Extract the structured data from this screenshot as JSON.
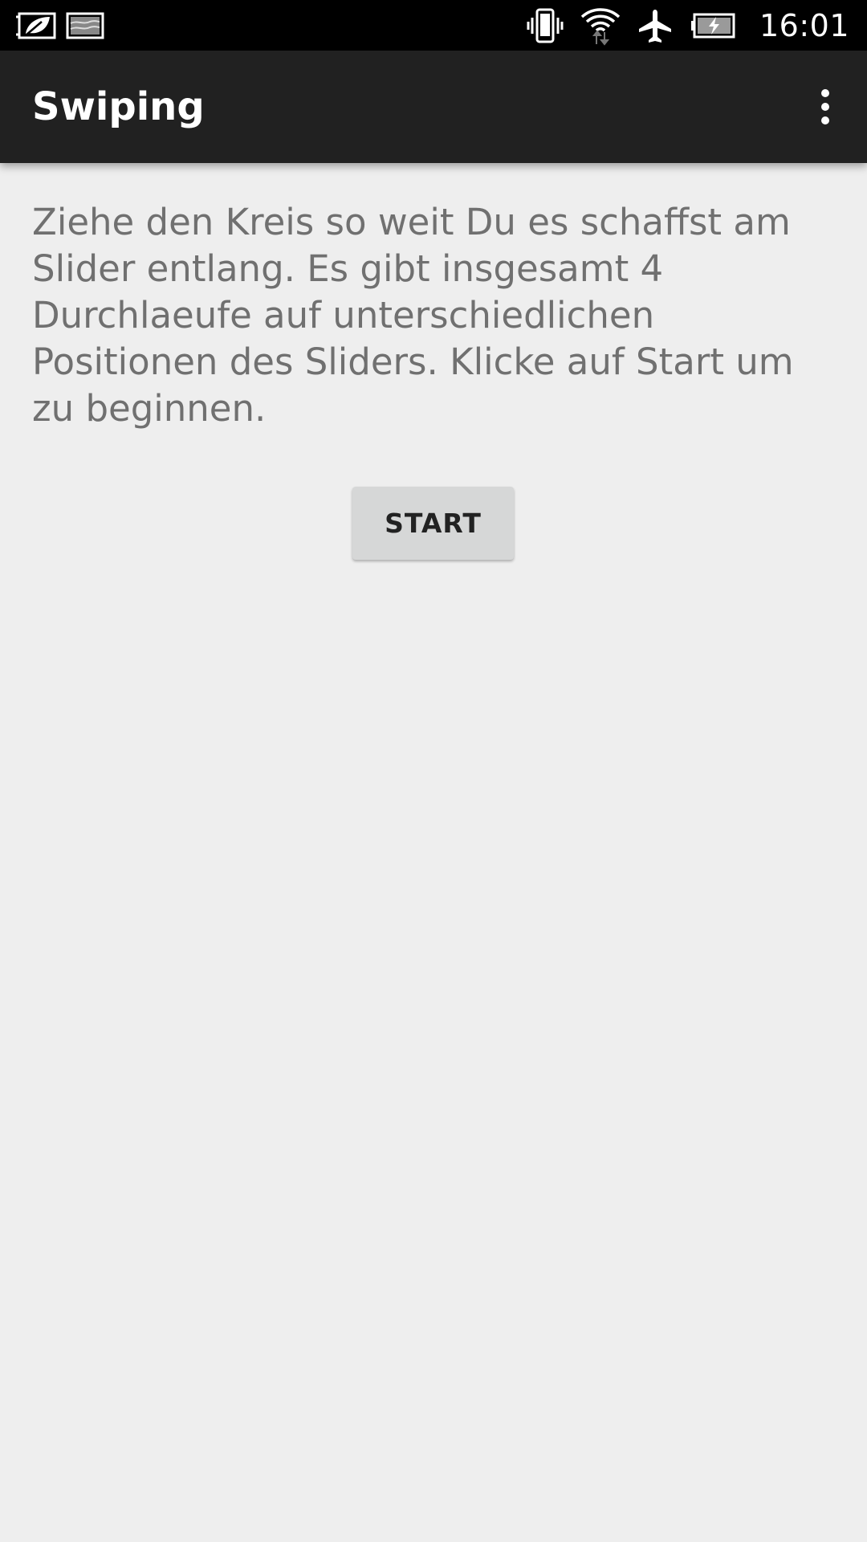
{
  "status_bar": {
    "time": "16:01",
    "icons": [
      "leaf-notification-icon",
      "image-notification-icon",
      "vibrate-icon",
      "wifi-icon",
      "airplane-mode-icon",
      "battery-charging-icon"
    ]
  },
  "app_bar": {
    "title": "Swiping",
    "menu_icon": "overflow-menu-icon"
  },
  "content": {
    "instructions": "Ziehe den Kreis so weit Du es schaffst am Slider entlang. Es gibt insgesamt 4 Durchlaeufe auf unterschiedlichen Positionen des Sliders. Klicke auf Start um zu beginnen.",
    "start_label": "START"
  },
  "colors": {
    "status_bar": "#000000",
    "app_bar": "#212121",
    "background": "#eeeeee",
    "text": "#707070",
    "button": "#d6d7d7"
  }
}
